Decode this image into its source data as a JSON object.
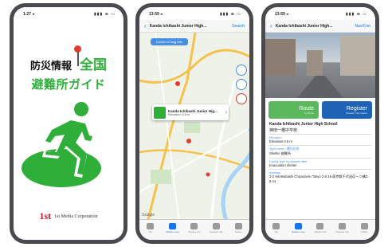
{
  "phones": [
    {
      "status": {
        "time": "1:27 ◂",
        "icons": "▮▮▮ ≋ ▭"
      },
      "splash": {
        "line1_prefix": "防災情報",
        "line1_green": "全国",
        "line2": "避難所ガイド"
      },
      "footer": {
        "logo_mark": "1st",
        "company": "1st Media Corporation"
      }
    },
    {
      "status": {
        "time": "13:59 ◂",
        "icons": "▮▮▮ ≋ ▭"
      },
      "nav": {
        "back": "‹",
        "title": "Kanda Ichibashi Junior High...",
        "action": "Search"
      },
      "map_chip": "Center of long info",
      "callout": {
        "title": "Kanda Ichibashi Junior Hig...",
        "subtitle": "Elevation: 0.6 m"
      },
      "google": "Google"
    },
    {
      "status": {
        "time": "13:59 ◂",
        "icons": "▮▮▮ ≋ ▭"
      },
      "nav": {
        "back": "‹",
        "title": "Kanda Ichibashi Junior High...",
        "action": "Nav/Con"
      },
      "buttons": {
        "route": {
          "label": "Route",
          "sub": "by Route"
        },
        "register": {
          "label": "Register",
          "sub": "Disaster information"
        }
      },
      "detail": {
        "name_en": "Kanda Ichibashi Junior High School",
        "name_ja": "神田一橋中学校",
        "rows": [
          {
            "label": "Elevation",
            "value": "Elevation 0.6 m"
          },
          {
            "label": "Type name / 種別名称",
            "value": "Shelter 避難所"
          },
          {
            "label": "Facility type by disaster filter",
            "value": "Evacuation shelter"
          },
          {
            "label": "Address",
            "value": "1-2 Hitotsubashi Chiyoda-ku Tokyo 2-8-16 東京都千代田区一ツ橋2-6-14"
          }
        ]
      }
    }
  ],
  "tabs": [
    "Top",
    "Shelter map",
    "Shelter info",
    "Disaster info",
    "Twitter"
  ]
}
